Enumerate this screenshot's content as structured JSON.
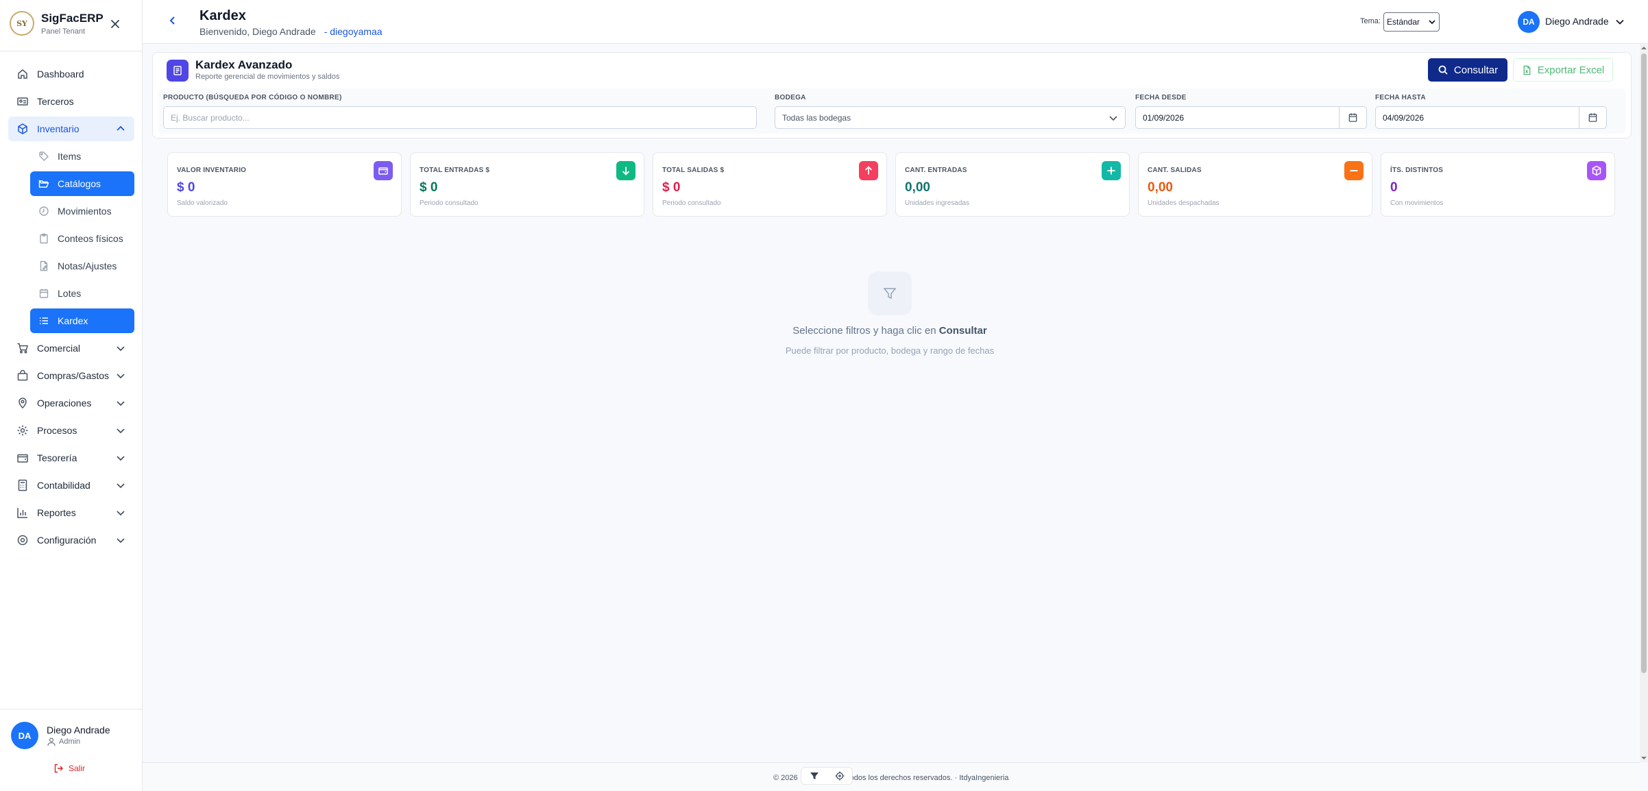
{
  "brand": {
    "name": "SigFacERP",
    "subtitle": "Panel Tenant",
    "logo_text": "SY"
  },
  "sidebar": {
    "items": [
      {
        "label": "Dashboard",
        "icon": "home-icon"
      },
      {
        "label": "Terceros",
        "icon": "id-card-icon"
      },
      {
        "label": "Inventario",
        "icon": "box-icon",
        "open": true
      },
      {
        "label": "Comercial",
        "icon": "cart-icon"
      },
      {
        "label": "Compras/Gastos",
        "icon": "bag-icon"
      },
      {
        "label": "Operaciones",
        "icon": "map-pin-icon"
      },
      {
        "label": "Procesos",
        "icon": "gear-icon"
      },
      {
        "label": "Tesorería",
        "icon": "wallet-icon"
      },
      {
        "label": "Contabilidad",
        "icon": "calculator-icon"
      },
      {
        "label": "Reportes",
        "icon": "bar-chart-icon"
      },
      {
        "label": "Configuración",
        "icon": "settings-icon"
      }
    ],
    "inventory_sub": [
      {
        "label": "Items",
        "icon": "tag-icon"
      },
      {
        "label": "Catálogos",
        "icon": "folder-open-icon",
        "active": true
      },
      {
        "label": "Movimientos",
        "icon": "clock-icon"
      },
      {
        "label": "Conteos físicos",
        "icon": "clipboard-icon"
      },
      {
        "label": "Notas/Ajustes",
        "icon": "file-edit-icon"
      },
      {
        "label": "Lotes",
        "icon": "calendar-icon"
      },
      {
        "label": "Kardex",
        "icon": "list-icon",
        "active": true
      }
    ],
    "user": {
      "initials": "DA",
      "name": "Diego Andrade",
      "role": "Admin",
      "logout": "Salir"
    }
  },
  "header": {
    "title": "Kardex",
    "welcome": "Bienvenido, Diego Andrade",
    "username": "- diegoyamaa",
    "theme_label": "Tema:",
    "theme_value": "Estándar",
    "user_initials": "DA",
    "user_name": "Diego Andrade"
  },
  "panel": {
    "title": "Kardex Avanzado",
    "subtitle": "Reporte gerencial de movimientos y saldos",
    "consult_button": "Consultar",
    "export_button": "Exportar Excel",
    "filters": {
      "product_label": "Producto (búsqueda por código o nombre)",
      "product_placeholder": "Ej. Buscar producto...",
      "warehouse_label": "Bodega",
      "warehouse_value": "Todas las bodegas",
      "date_from_label": "Fecha desde",
      "date_from_value": "01/09/2026",
      "date_to_label": "Fecha hasta",
      "date_to_value": "04/09/2026"
    }
  },
  "stats": [
    {
      "label": "Valor Inventario",
      "value": "$ 0",
      "sub": "Saldo valorizado",
      "color": "#4f46e5",
      "icon_bg": "#7c5cf0",
      "icon": "wallet-icon"
    },
    {
      "label": "Total Entradas $",
      "value": "$ 0",
      "sub": "Periodo consultado",
      "color": "#047857",
      "icon_bg": "#10b981",
      "icon": "arrow-down-icon"
    },
    {
      "label": "Total Salidas $",
      "value": "$ 0",
      "sub": "Periodo consultado",
      "color": "#e11d48",
      "icon_bg": "#f43f5e",
      "icon": "arrow-up-icon"
    },
    {
      "label": "Cant. Entradas",
      "value": "0,00",
      "sub": "Unidades ingresadas",
      "color": "#0f766e",
      "icon_bg": "#14b8a6",
      "icon": "plus-icon"
    },
    {
      "label": "Cant. Salidas",
      "value": "0,00",
      "sub": "Unidades despachadas",
      "color": "#ea580c",
      "icon_bg": "#f97316",
      "icon": "minus-icon"
    },
    {
      "label": "Íts. distintos",
      "value": "0",
      "sub": "Con movimientos",
      "color": "#7e22ce",
      "icon_bg": "#a855f7",
      "icon": "cube-icon"
    }
  ],
  "empty_state": {
    "title_prefix": "Seleccione filtros y haga clic en",
    "title_action": "Consultar",
    "subtitle": "Puede filtrar por producto, bodega y rango de fechas"
  },
  "footer": {
    "text_left": "© 2026",
    "text_right": "odos los derechos reservados. · ItdyaIngenieria"
  }
}
